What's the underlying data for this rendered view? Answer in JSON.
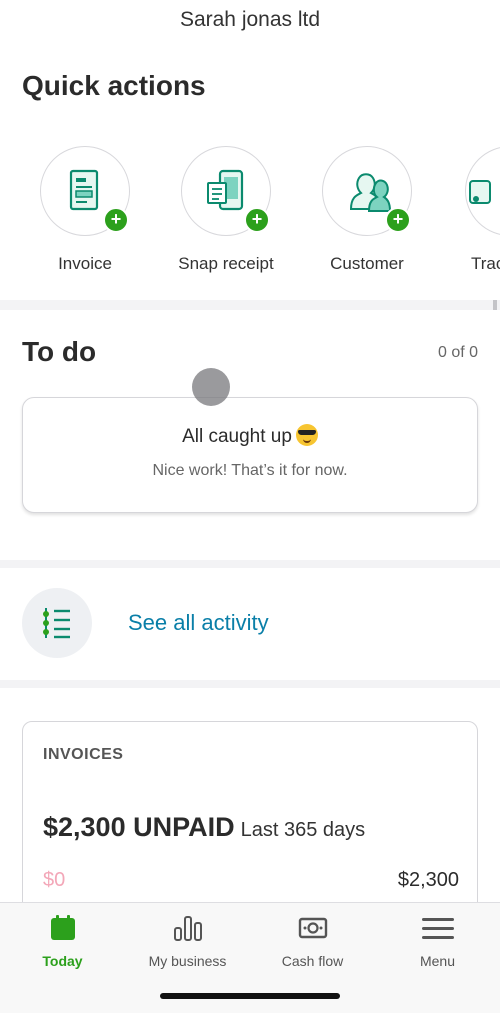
{
  "header": {
    "company_name": "Sarah jonas ltd"
  },
  "quick_actions": {
    "title": "Quick actions",
    "items": [
      {
        "label": "Invoice",
        "icon": "invoice-icon"
      },
      {
        "label": "Snap receipt",
        "icon": "receipt-icon"
      },
      {
        "label": "Customer",
        "icon": "customer-icon"
      },
      {
        "label": "Trac",
        "icon": "track-icon"
      }
    ]
  },
  "todo": {
    "title": "To do",
    "count": "0 of 0",
    "card_title": "All caught up",
    "card_emoji": "sunglasses-face-emoji",
    "card_subtitle": "Nice work! That’s it for now."
  },
  "activity": {
    "link_label": "See all activity",
    "icon": "activity-list-icon"
  },
  "invoices": {
    "label": "INVOICES",
    "amount": "$2,300 UNPAID",
    "period": "Last 365 days",
    "left_value": "$0",
    "right_value": "$2,300"
  },
  "tabbar": {
    "items": [
      {
        "label": "Today",
        "icon": "calendar-icon",
        "active": true
      },
      {
        "label": "My business",
        "icon": "bar-chart-icon",
        "active": false
      },
      {
        "label": "Cash flow",
        "icon": "cash-icon",
        "active": false
      },
      {
        "label": "Menu",
        "icon": "hamburger-menu-icon",
        "active": false
      }
    ]
  },
  "colors": {
    "brand_green": "#2ca01c",
    "link_blue": "#0a7fa8",
    "icon_teal": "#0b8a6e"
  }
}
